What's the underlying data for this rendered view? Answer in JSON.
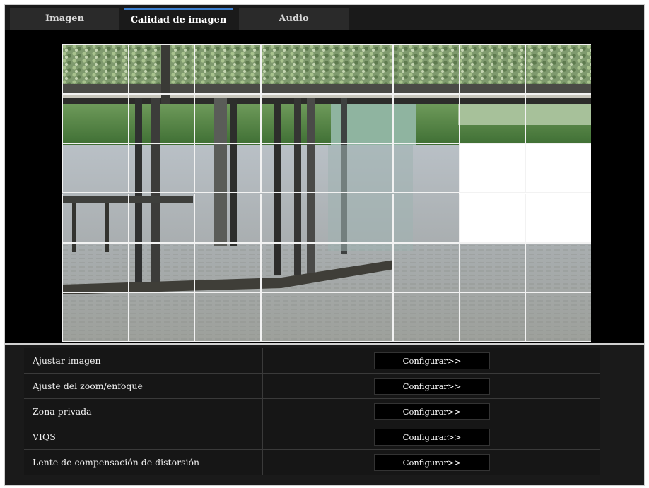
{
  "tabs": [
    {
      "label": "Imagen",
      "active": false
    },
    {
      "label": "Calidad de imagen",
      "active": true
    },
    {
      "label": "Audio",
      "active": false
    }
  ],
  "preview": {
    "grid_columns": 8,
    "grid_rows": 6,
    "masked_cells": [
      "r3c7",
      "r3c8",
      "r4c7",
      "r4c8"
    ]
  },
  "settings": [
    {
      "label": "Ajustar imagen",
      "button": "Configurar>>"
    },
    {
      "label": "Ajuste del zoom/enfoque",
      "button": "Configurar>>"
    },
    {
      "label": "Zona privada",
      "button": "Configurar>>"
    },
    {
      "label": "VIQS",
      "button": "Configurar>>"
    },
    {
      "label": "Lente de compensación de distorsión",
      "button": "Configurar>>"
    }
  ],
  "colors": {
    "accent_tab": "#3b7fd1",
    "background": "#1a1a1a",
    "mask": "#ffffff"
  }
}
